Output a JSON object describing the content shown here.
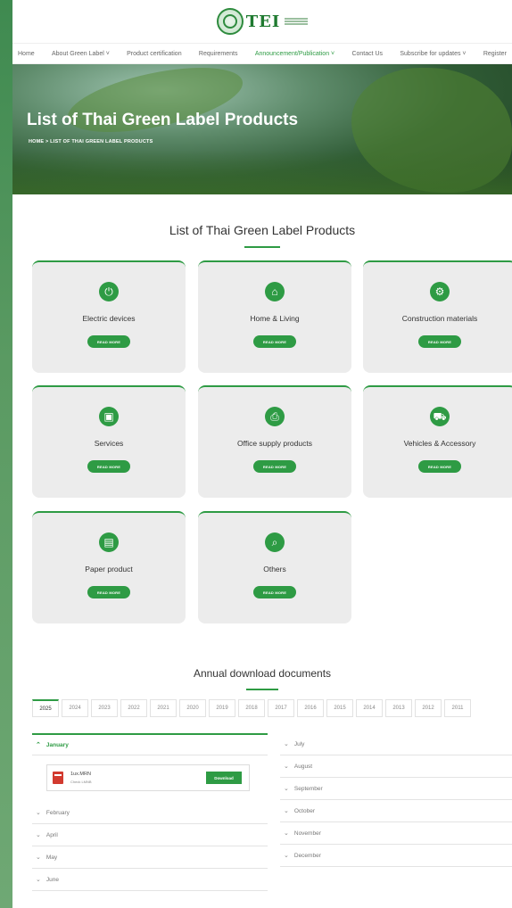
{
  "header": {
    "logo_text": "TEI"
  },
  "nav": {
    "items": [
      {
        "label": "Home"
      },
      {
        "label": "About Green Label ˅"
      },
      {
        "label": "Product certification"
      },
      {
        "label": "Requirements"
      },
      {
        "label": "Announcement/Publication ˅"
      },
      {
        "label": "Contact Us"
      },
      {
        "label": "Subscribe for updates ˅"
      },
      {
        "label": "Register"
      }
    ]
  },
  "hero": {
    "title": "List of Thai Green Label Products",
    "breadcrumb": "HOME   >  LIST OF THAI GREEN LABEL PRODUCTS"
  },
  "products": {
    "title": "List of Thai Green Label Products",
    "read_more": "READ MORE",
    "categories": [
      {
        "label": "Electric devices",
        "icon": "power-icon",
        "glyph": "⏻"
      },
      {
        "label": "Home & Living",
        "icon": "house-icon",
        "glyph": "⌂"
      },
      {
        "label": "Construction materials",
        "icon": "gear-icon",
        "glyph": "⚙"
      },
      {
        "label": "Services",
        "icon": "briefcase-icon",
        "glyph": "▣"
      },
      {
        "label": "Office supply products",
        "icon": "printer-icon",
        "glyph": "⎙"
      },
      {
        "label": "Vehicles & Accessory",
        "icon": "car-icon",
        "glyph": "⛟"
      },
      {
        "label": "Paper product",
        "icon": "book-icon",
        "glyph": "▤"
      },
      {
        "label": "Others",
        "icon": "search-icon",
        "glyph": "⌕"
      }
    ]
  },
  "downloads": {
    "title": "Annual download documents",
    "years": [
      "2025",
      "2024",
      "2023",
      "2022",
      "2021",
      "2020",
      "2019",
      "2018",
      "2017",
      "2016",
      "2015",
      "2014",
      "2013",
      "2012",
      "2011"
    ],
    "months_left": [
      "January",
      "February",
      "April",
      "May",
      "June"
    ],
    "months_right": [
      "July",
      "August",
      "September",
      "October",
      "November",
      "December"
    ],
    "open_month": "January",
    "document": {
      "name": "1ux.MRN",
      "meta": "Check  LMNB",
      "download_label": "Download"
    }
  },
  "colors": {
    "accent": "#2e9b44",
    "card_bg": "#ececec",
    "outer_bg": "#4d9258"
  }
}
